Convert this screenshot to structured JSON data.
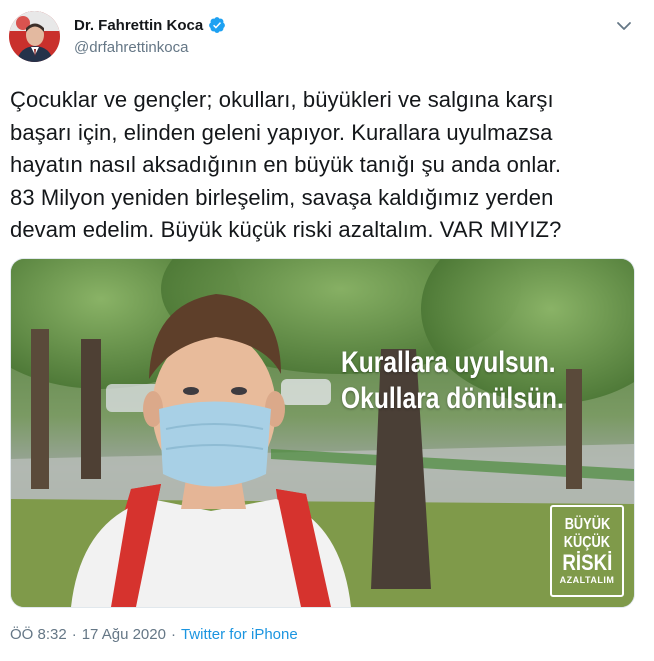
{
  "author": {
    "name": "Dr. Fahrettin Koca",
    "handle": "@drfahrettinkoca",
    "verified": true
  },
  "tweet": {
    "text": "Çocuklar ve gençler; okulları, büyükleri ve salgına karşı\nbaşarı için, elinden geleni yapıyor. Kurallara uyulmazsa\nhayatın nasıl aksadığının en büyük tanığı şu anda onlar.\n83 Milyon yeniden birleşelim, savaşa kaldığımız yerden\ndevam edelim. Büyük küçük riski azaltalım. VAR MIYIZ?"
  },
  "media": {
    "overlay_text": "Kurallara uyulsun.\nOkullara dönülsün.",
    "badge": {
      "line1": "BÜYÜK",
      "line2": "KÜÇÜK",
      "line3": "RİSKİ",
      "line4": "AZALTALIM"
    }
  },
  "meta": {
    "time": "ÖÖ 8:32",
    "separator1": "·",
    "date": "17 Ağu 2020",
    "separator2": "·",
    "source": "Twitter for iPhone"
  },
  "colors": {
    "text": "#14171a",
    "secondary": "#657786",
    "link": "#1b95e0",
    "verified": "#1da1f2"
  },
  "icons": {
    "verified": "verified-badge-icon",
    "caret": "chevron-down-icon"
  }
}
